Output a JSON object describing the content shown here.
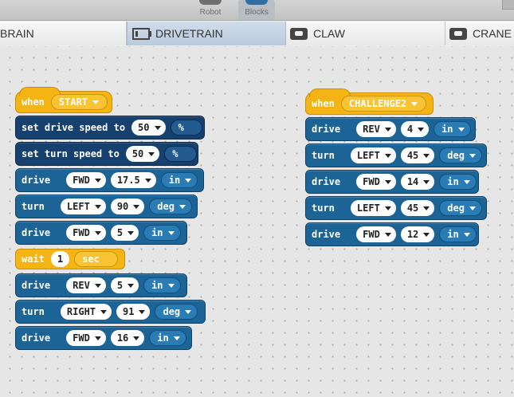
{
  "toolbar": {
    "robot_label": "Robot",
    "blocks_label": "Blocks"
  },
  "tabs": [
    {
      "label": "BRAIN",
      "icon": "brain-icon",
      "active": false
    },
    {
      "label": "DRIVETRAIN",
      "icon": "drivetrain-icon",
      "active": true
    },
    {
      "label": "CLAW",
      "icon": "claw-icon",
      "active": false
    },
    {
      "label": "CRANE",
      "icon": "crane-icon",
      "active": false
    }
  ],
  "scripts": {
    "left": {
      "hat": {
        "keyword": "when",
        "event": "START"
      },
      "set_drive_speed": {
        "text": "set drive speed to",
        "value": "50",
        "unit": "%"
      },
      "set_turn_speed": {
        "text": "set turn speed to",
        "value": "50",
        "unit": "%"
      },
      "b1": {
        "keyword": "drive",
        "dir": "FWD",
        "amount": "17.5",
        "unit": "in"
      },
      "b2": {
        "keyword": "turn",
        "dir": "LEFT",
        "amount": "90",
        "unit": "deg"
      },
      "b3": {
        "keyword": "drive",
        "dir": "FWD",
        "amount": "5",
        "unit": "in"
      },
      "wait": {
        "keyword": "wait",
        "amount": "1",
        "unit": "sec"
      },
      "b4": {
        "keyword": "drive",
        "dir": "REV",
        "amount": "5",
        "unit": "in"
      },
      "b5": {
        "keyword": "turn",
        "dir": "RIGHT",
        "amount": "91",
        "unit": "deg"
      },
      "b6": {
        "keyword": "drive",
        "dir": "FWD",
        "amount": "16",
        "unit": "in"
      }
    },
    "right": {
      "hat": {
        "keyword": "when",
        "event": "CHALLENGE2"
      },
      "b1": {
        "keyword": "drive",
        "dir": "REV",
        "amount": "4",
        "unit": "in"
      },
      "b2": {
        "keyword": "turn",
        "dir": "LEFT",
        "amount": "45",
        "unit": "deg"
      },
      "b3": {
        "keyword": "drive",
        "dir": "FWD",
        "amount": "14",
        "unit": "in"
      },
      "b4": {
        "keyword": "turn",
        "dir": "LEFT",
        "amount": "45",
        "unit": "deg"
      },
      "b5": {
        "keyword": "drive",
        "dir": "FWD",
        "amount": "12",
        "unit": "in"
      }
    }
  },
  "colors": {
    "motion_block": "#1c6396",
    "speed_block": "#16406d",
    "event_block": "#f4b414",
    "active_tab": "#c6d4e4"
  }
}
